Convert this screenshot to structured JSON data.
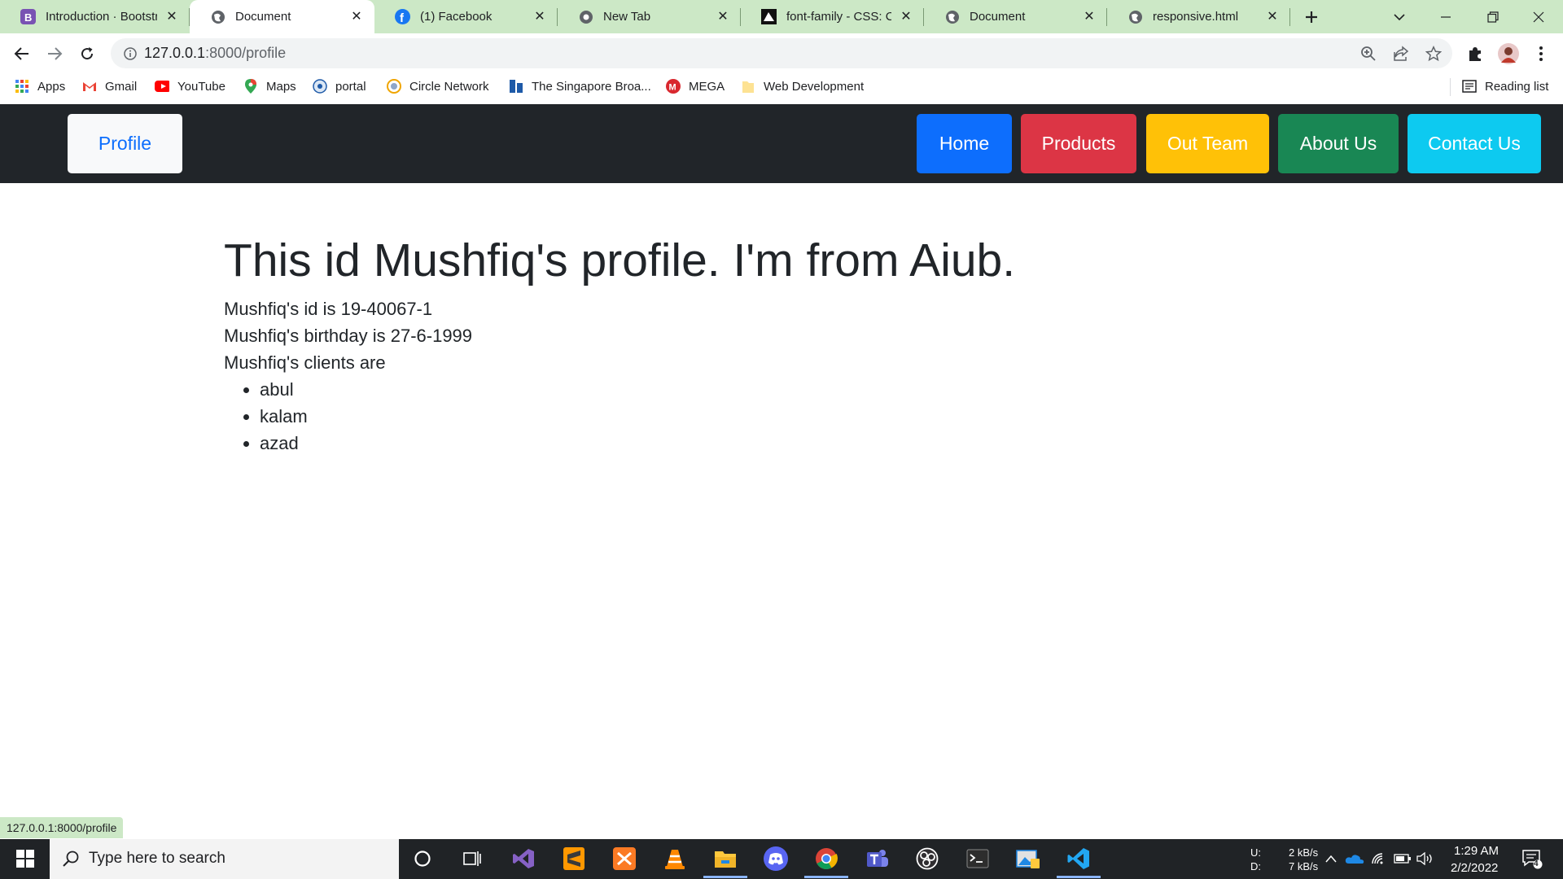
{
  "browser": {
    "tabs": [
      {
        "title": "Introduction · Bootstrap",
        "icon": "bootstrap-icon",
        "active": false
      },
      {
        "title": "Document",
        "icon": "globe-icon",
        "active": true
      },
      {
        "title": "(1) Facebook",
        "icon": "facebook-icon",
        "active": false
      },
      {
        "title": "New Tab",
        "icon": "chrome-icon",
        "active": false
      },
      {
        "title": "font-family - CSS: Cascading",
        "icon": "mdn-icon",
        "active": false
      },
      {
        "title": "Document",
        "icon": "globe-icon",
        "active": false
      },
      {
        "title": "responsive.html",
        "icon": "globe-icon",
        "active": false
      }
    ],
    "url_host": "127.0.0.1",
    "url_path": ":8000/profile",
    "bookmarks": [
      {
        "label": "Apps",
        "icon": "apps-grid-icon"
      },
      {
        "label": "Gmail",
        "icon": "gmail-icon"
      },
      {
        "label": "YouTube",
        "icon": "youtube-icon"
      },
      {
        "label": "Maps",
        "icon": "maps-icon"
      },
      {
        "label": "portal",
        "icon": "portal-icon"
      },
      {
        "label": "Circle Network",
        "icon": "circle-network-icon"
      },
      {
        "label": "The Singapore Broa...",
        "icon": "singapore-icon"
      },
      {
        "label": "MEGA",
        "icon": "mega-icon"
      },
      {
        "label": "Web Development",
        "icon": "folder-icon"
      }
    ],
    "reading_list": "Reading list",
    "status_url": "127.0.0.1:8000/profile"
  },
  "navbar": {
    "brand": "Profile",
    "links": [
      {
        "label": "Home",
        "color": "#0d6efd"
      },
      {
        "label": "Products",
        "color": "#dc3545"
      },
      {
        "label": "Out Team",
        "color": "#ffc107"
      },
      {
        "label": "About Us",
        "color": "#198754"
      },
      {
        "label": "Contact Us",
        "color": "#0dcaf0"
      }
    ]
  },
  "profile": {
    "heading": "This id Mushfiq's profile. I'm from Aiub.",
    "id_line": "Mushfiq's id is 19-40067-1",
    "birthday_line": "Mushfiq's birthday is 27-6-1999",
    "clients_line": "Mushfiq's clients are",
    "clients": [
      "abul",
      "kalam",
      "azad"
    ]
  },
  "taskbar": {
    "search_placeholder": "Type here to search",
    "net_up_label": "U:",
    "net_down_label": "D:",
    "net_up": "2 kB/s",
    "net_down": "7 kB/s",
    "time": "1:29 AM",
    "date": "2/2/2022",
    "notifications": "4"
  }
}
